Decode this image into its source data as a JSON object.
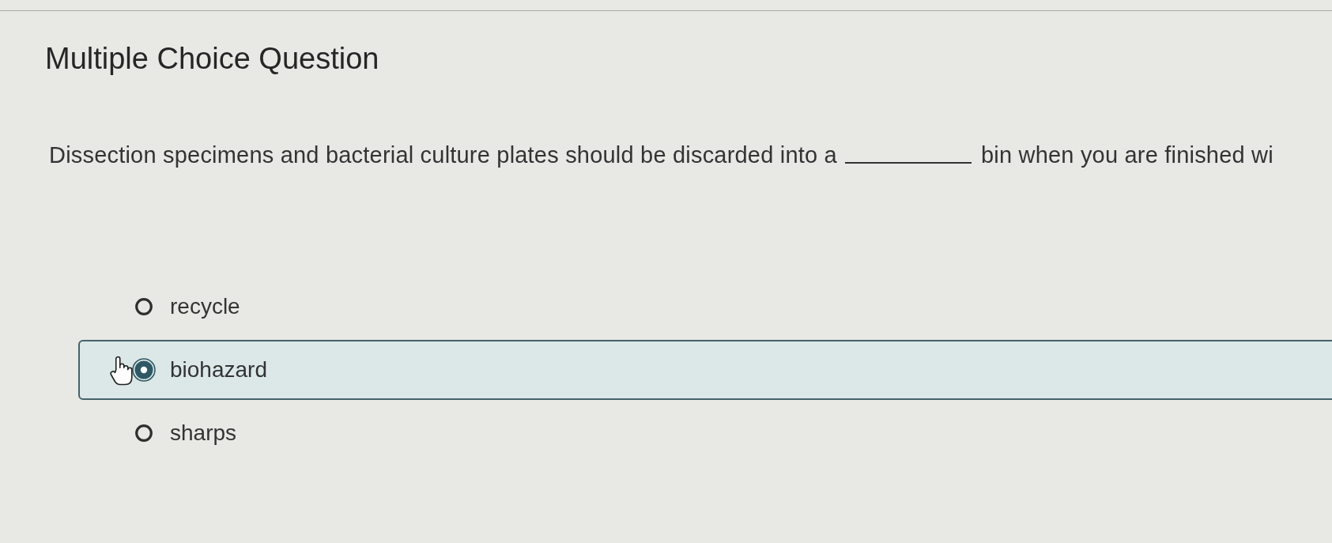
{
  "title": "Multiple Choice Question",
  "question": [
    {
      "kind": "text",
      "text": "Dissection specimens and bacterial culture plates should be discarded into a"
    },
    {
      "kind": "blank"
    },
    {
      "kind": "text",
      "text": "bin when you are finished wi"
    }
  ],
  "options": [
    {
      "label": "recycle",
      "selected": false,
      "hovered": false
    },
    {
      "label": "biohazard",
      "selected": true,
      "hovered": true
    },
    {
      "label": "sharps",
      "selected": false,
      "hovered": false
    }
  ]
}
